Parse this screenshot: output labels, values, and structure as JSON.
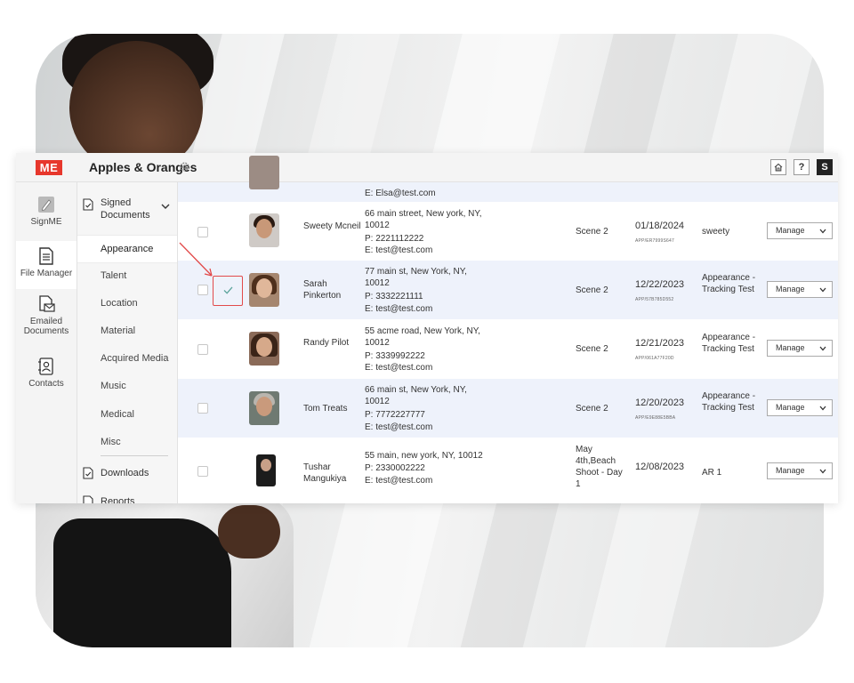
{
  "app": {
    "title": "Apples & Oranges"
  },
  "topbar": {
    "help_label": "?",
    "user_initial": "S"
  },
  "logo": {
    "text": "ME",
    "color": "#e7372c"
  },
  "rail": {
    "items": [
      {
        "label": "SignME",
        "icon": "pen-icon"
      },
      {
        "label": "File Manager",
        "icon": "file-icon"
      },
      {
        "label": "Emailed Documents",
        "icon": "email-doc-icon"
      },
      {
        "label": "Contacts",
        "icon": "contact-icon"
      }
    ],
    "active": "File Manager"
  },
  "subnav": {
    "group": {
      "label": "Signed Documents"
    },
    "items": [
      "Appearance",
      "Talent",
      "Location",
      "Material",
      "Acquired Media",
      "Music",
      "Medical",
      "Misc"
    ],
    "active": "Appearance",
    "downloads": "Downloads",
    "reports": "Reports"
  },
  "table": {
    "partial_row": {
      "email": "E: Elsa@test.com"
    },
    "rows": [
      {
        "name": "Sweety Mcneil",
        "address": "66 main street, New york, NY, 10012",
        "phone": "P: 2221112222",
        "email": "E: test@test.com",
        "scene": "Scene 2",
        "date": "01/18/2024",
        "app_id": "APP/ER7999S647",
        "type": "sweety",
        "action": "Manage",
        "checked": false
      },
      {
        "name": "Sarah Pinkerton",
        "address": "77 main st, New York, NY, 10012",
        "phone": "P: 3332221111",
        "email": "E: test@test.com",
        "scene": "Scene 2",
        "date": "12/22/2023",
        "app_id": "APP/57B785D552",
        "type": "Appearance - Tracking Test",
        "action": "Manage",
        "checked": true
      },
      {
        "name": "Randy Pilot",
        "address": "55 acme road, New York, NY, 10012",
        "phone": "P: 3339992222",
        "email": "E: test@test.com",
        "scene": "Scene 2",
        "date": "12/21/2023",
        "app_id": "APP/061A77F20D",
        "type": "Appearance - Tracking Test",
        "action": "Manage",
        "checked": false
      },
      {
        "name": "Tom Treats",
        "address": "66 main st, New York, NY, 10012",
        "phone": "P: 7772227777",
        "email": "E: test@test.com",
        "scene": "Scene 2",
        "date": "12/20/2023",
        "app_id": "APP/E9E88E5BBA",
        "type": "Appearance - Tracking Test",
        "action": "Manage",
        "checked": false
      },
      {
        "name": "Tushar Mangukiya",
        "address": "55 main, new york, NY, 10012",
        "phone": "P: 2330002222",
        "email": "E: test@test.com",
        "scene": "May 4th,Beach Shoot - Day 1",
        "date": "12/08/2023",
        "app_id": "",
        "type": "AR 1",
        "action": "Manage",
        "checked": false
      }
    ]
  },
  "colors": {
    "accent_red": "#e7372c",
    "row_alt": "#eef2fb",
    "highlight_red": "#e24a4a",
    "check_teal": "#5aa39a"
  }
}
